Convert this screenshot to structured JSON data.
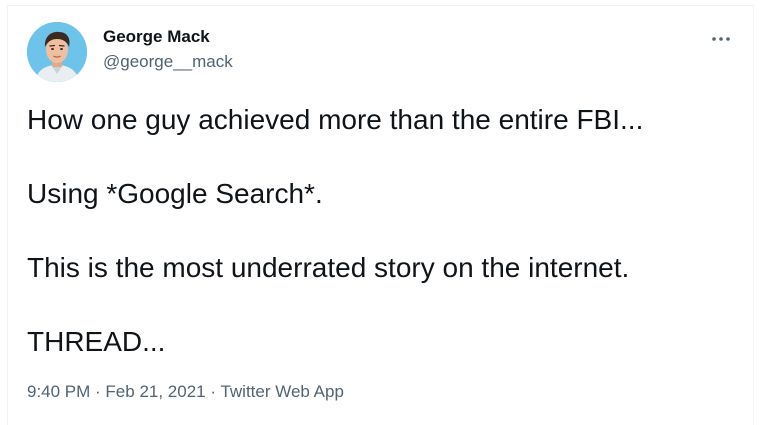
{
  "author": {
    "display_name": "George Mack",
    "handle": "@george__mack"
  },
  "more_menu": {
    "icon": "more-horizontal-icon"
  },
  "tweet": {
    "lines": [
      "How one guy achieved more than the entire FBI...",
      "Using *Google Search*.",
      "This is the most underrated story on the internet.",
      "THREAD..."
    ],
    "time": "9:40 PM",
    "separator": " · ",
    "date": "Feb 21, 2021",
    "source": "Twitter Web App"
  },
  "colors": {
    "text_primary": "#0f1419",
    "text_secondary": "#536471",
    "border": "#eff3f4",
    "avatar_background": "#6ec3ea"
  }
}
